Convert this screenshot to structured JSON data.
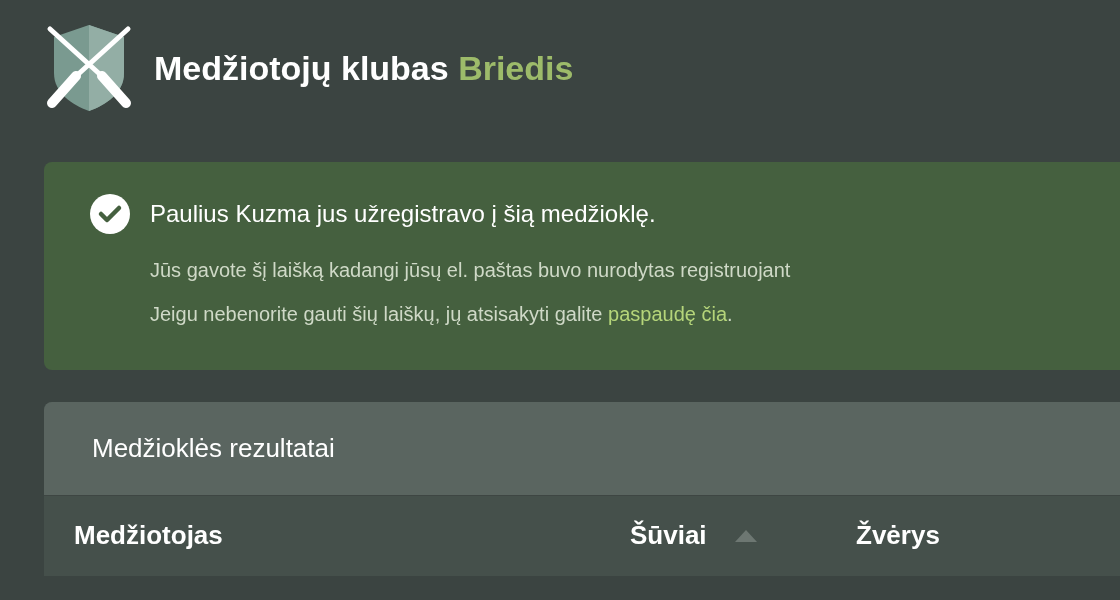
{
  "header": {
    "title": "Medžiotojų klubas",
    "title_accent": "Briedis"
  },
  "alert": {
    "heading": "Paulius Kuzma jus užregistravo į šią medžioklę.",
    "line_1": "Jūs gavote šį laišką kadangi jūsų el. paštas buvo nurodytas registruojant",
    "line_2": "Jeigu nebenorite gauti šių laiškų, jų atsisakyti galite",
    "link": "paspaudę čia",
    "line_2_end": "."
  },
  "results_card": {
    "title": "Medžioklės rezultatai",
    "columns": [
      {
        "label": "Medžiotojas",
        "sorted": false
      },
      {
        "label": "Šūviai",
        "sorted": true
      },
      {
        "label": "Žvėrys",
        "sorted": false
      }
    ]
  }
}
